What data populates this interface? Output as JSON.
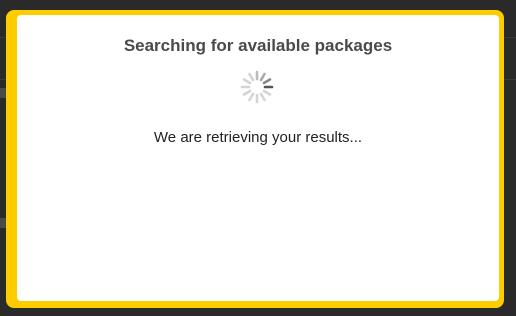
{
  "modal": {
    "title": "Searching for available packages",
    "message": "We are retrieving your results...",
    "spinner_icon": "loading-spinner-icon"
  },
  "colors": {
    "frame": "#ffcc00",
    "panel": "#ffffff",
    "title_text": "#4a4a4a",
    "message_text": "#222222",
    "backdrop": "#2a2a2a",
    "spinner_active": "#555555",
    "spinner_inactive": "#d4d4d4"
  }
}
